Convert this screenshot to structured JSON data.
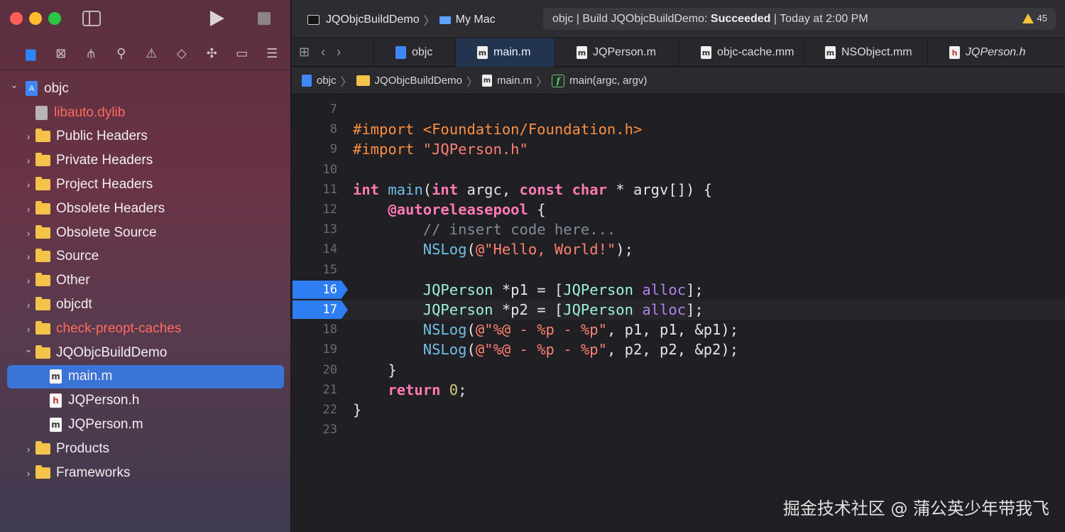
{
  "toolbar": {
    "scheme": "JQObjcBuildDemo",
    "destination": "My Mac",
    "status_prefix": "objc | Build JQObjcBuildDemo: ",
    "status_result": "Succeeded",
    "status_suffix": " | Today at 2:00 PM",
    "warnings": "45"
  },
  "navigator_icons": [
    "folder-icon",
    "source-control-icon",
    "hierarchy-icon",
    "search-icon",
    "issue-icon",
    "test-icon",
    "debug-icon",
    "breakpoint-icon",
    "report-icon"
  ],
  "tree": [
    {
      "label": "objc",
      "kind": "project",
      "expanded": true,
      "indent": 0
    },
    {
      "label": "libauto.dylib",
      "kind": "lib",
      "red": true,
      "indent": 1
    },
    {
      "label": "Public Headers",
      "kind": "folder",
      "indent": 1
    },
    {
      "label": "Private Headers",
      "kind": "folder",
      "indent": 1
    },
    {
      "label": "Project Headers",
      "kind": "folder",
      "indent": 1
    },
    {
      "label": "Obsolete Headers",
      "kind": "folder",
      "indent": 1
    },
    {
      "label": "Obsolete Source",
      "kind": "folder",
      "indent": 1
    },
    {
      "label": "Source",
      "kind": "folder",
      "indent": 1
    },
    {
      "label": "Other",
      "kind": "folder",
      "indent": 1
    },
    {
      "label": "objcdt",
      "kind": "folder",
      "indent": 1
    },
    {
      "label": "check-preopt-caches",
      "kind": "folder",
      "red": true,
      "indent": 1
    },
    {
      "label": "JQObjcBuildDemo",
      "kind": "folder",
      "expanded": true,
      "indent": 1
    },
    {
      "label": "main.m",
      "kind": "m",
      "selected": true,
      "indent": 2
    },
    {
      "label": "JQPerson.h",
      "kind": "h",
      "indent": 2
    },
    {
      "label": "JQPerson.m",
      "kind": "m",
      "indent": 2
    },
    {
      "label": "Products",
      "kind": "folder",
      "indent": 1
    },
    {
      "label": "Frameworks",
      "kind": "folder",
      "indent": 1
    }
  ],
  "tabs": [
    {
      "label": "objc",
      "icon": "proj"
    },
    {
      "label": "main.m",
      "icon": "m",
      "active": true
    },
    {
      "label": "JQPerson.m",
      "icon": "m"
    },
    {
      "label": "objc-cache.mm",
      "icon": "m"
    },
    {
      "label": "NSObject.mm",
      "icon": "m"
    },
    {
      "label": "JQPerson.h",
      "icon": "h",
      "italic": true
    }
  ],
  "jumpbar": {
    "project": "objc",
    "group": "JQObjcBuildDemo",
    "file": "main.m",
    "symbol": "main(argc, argv)"
  },
  "code_lines": [
    {
      "num": "7",
      "html": ""
    },
    {
      "num": "8",
      "html": "<span class=\"pp\">#import &lt;Foundation/Foundation.h&gt;</span>"
    },
    {
      "num": "9",
      "html": "<span class=\"pp\">#import </span><span class=\"str\">\"JQPerson.h\"</span>"
    },
    {
      "num": "10",
      "html": ""
    },
    {
      "num": "11",
      "html": "<span class=\"kw\">int</span> <span class=\"fn\">main</span>(<span class=\"kw\">int</span> argc, <span class=\"kw\">const</span> <span class=\"kw\">char</span> * argv[]) {"
    },
    {
      "num": "12",
      "html": "    <span class=\"kw\">@autoreleasepool</span> {"
    },
    {
      "num": "13",
      "html": "        <span class=\"cmt\">// insert code here...</span>"
    },
    {
      "num": "14",
      "html": "        <span class=\"fn\">NSLog</span>(<span class=\"str\">@\"Hello, World!\"</span>);"
    },
    {
      "num": "15",
      "html": ""
    },
    {
      "num": "16",
      "html": "        <span class=\"cls\">JQPerson</span> *p1 = [<span class=\"cls\">JQPerson</span> <span class=\"msg\">alloc</span>];",
      "breakpoint": true
    },
    {
      "num": "17",
      "html": "        <span class=\"cls\">JQPerson</span> *p2 = [<span class=\"cls\">JQPerson</span> <span class=\"msg\">alloc</span>];",
      "breakpoint": true,
      "current": true
    },
    {
      "num": "18",
      "html": "        <span class=\"fn\">NSLog</span>(<span class=\"str\">@\"%@ - %p - %p\"</span>, p1, p1, &amp;p1);"
    },
    {
      "num": "19",
      "html": "        <span class=\"fn\">NSLog</span>(<span class=\"str\">@\"%@ - %p - %p\"</span>, p2, p2, &amp;p2);"
    },
    {
      "num": "20",
      "html": "    }"
    },
    {
      "num": "21",
      "html": "    <span class=\"kw\">return</span> <span class=\"num\">0</span>;"
    },
    {
      "num": "22",
      "html": "}"
    },
    {
      "num": "23",
      "html": ""
    }
  ],
  "watermark": "掘金技术社区 @ 蒲公英少年带我飞",
  "colors": {
    "accent": "#2f7df2",
    "selection": "#3a74d6",
    "folder": "#f3c34a",
    "missing_file": "#ff6b5f"
  }
}
